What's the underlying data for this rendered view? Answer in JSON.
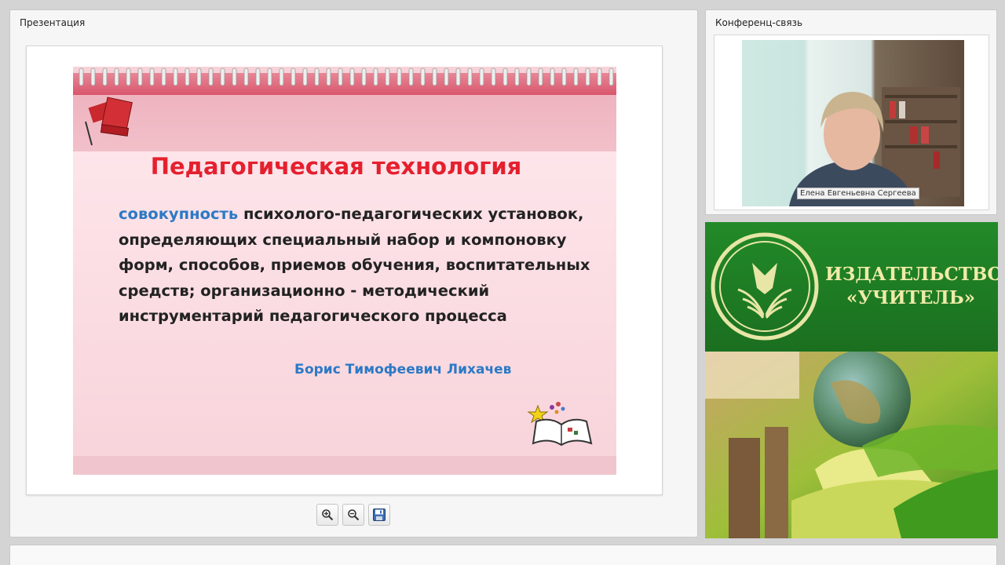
{
  "presentation": {
    "title": "Презентация",
    "slide": {
      "heading": "Педагогическая технология",
      "definition_highlight": "совокупность",
      "definition_text": " психолого-педагогических установок, определяющих специальный набор и компоновку форм, способов, приемов обучения, воспитательных средств; организационно - методический инструментарий педагогического процесса",
      "author": "Борис Тимофеевич Лихачев"
    },
    "controls": {
      "zoom_in_icon": "zoom-in-icon",
      "zoom_out_icon": "zoom-out-icon",
      "save_icon": "save-icon"
    }
  },
  "conference": {
    "title": "Конференц-связь",
    "speaker_name": "Елена Евгеньевна Сергеева"
  },
  "publisher": {
    "name_line1": "ИЗДАТЕЛЬСТВО",
    "name_line2": "«УЧИТЕЛЬ»"
  },
  "colors": {
    "slide_heading": "#e5202e",
    "slide_accent": "#2c79c6",
    "publisher_green": "#228a28",
    "publisher_text": "#f0eba8"
  }
}
